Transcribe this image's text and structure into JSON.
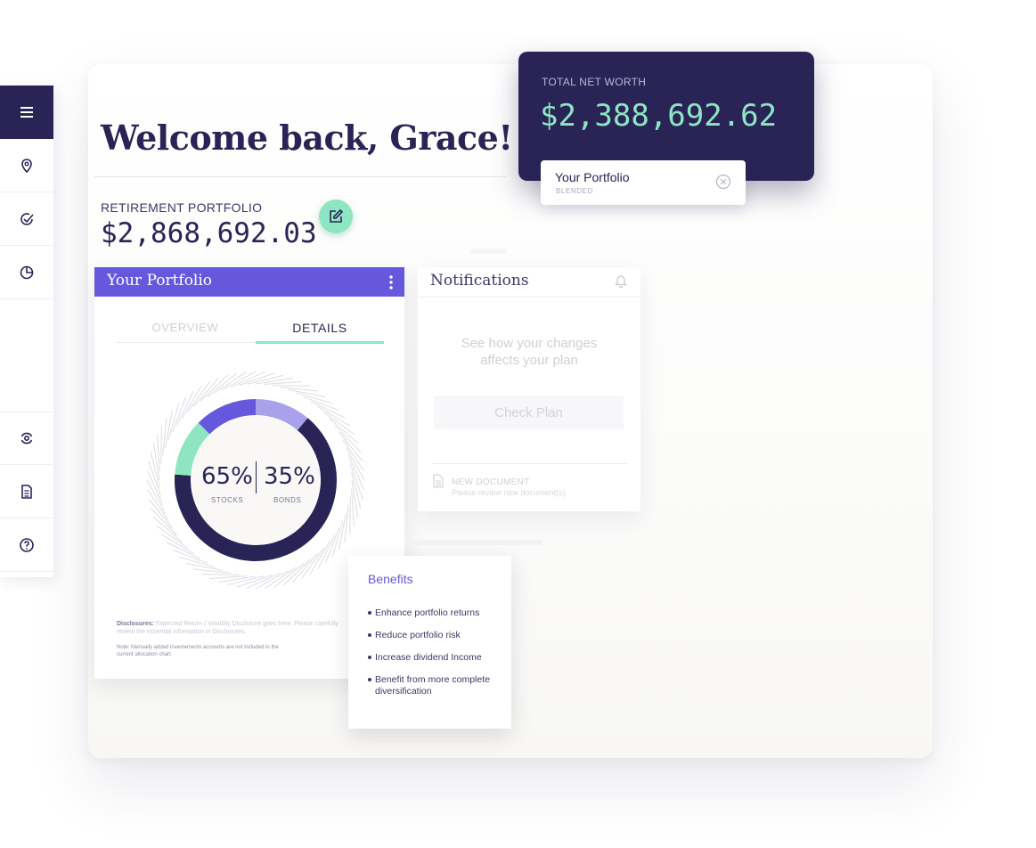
{
  "greeting": "Welcome back, Grace!",
  "retirement": {
    "label": "RETIREMENT PORTFOLIO",
    "value": "$2,868,692.03"
  },
  "net_worth": {
    "label": "TOTAL NET WORTH",
    "value": "$2,388,692.62"
  },
  "portfolio_pill": {
    "title": "Your Portfolio",
    "subtitle": "BLENDED"
  },
  "portfolio_card": {
    "title": "Your Portfolio",
    "tabs": [
      {
        "label": "OVERVIEW",
        "active": false
      },
      {
        "label": "DETAILS",
        "active": true
      }
    ],
    "allocation": {
      "stocks": {
        "percent": "65%",
        "label": "STOCKS",
        "value": 65
      },
      "bonds": {
        "percent": "35%",
        "label": "BONDS",
        "value": 35
      }
    },
    "disclosures_label": "Disclosures:",
    "disclosures_text": "Expected Return / Volatility Disclosure goes here. Please carefully review the essential information in Disclosures.",
    "note": "Note: Manually added investements accounts are not included in the current allocation chart."
  },
  "notifications": {
    "title": "Notifications",
    "message": "See how your changes affects your plan",
    "button": "Check Plan",
    "document": {
      "title": "NEW DOCUMENT",
      "subtitle": "Please review new document(s)"
    }
  },
  "benefits": {
    "title": "Benefits",
    "items": [
      "Enhance portfolio returns",
      "Reduce portfolio risk",
      "Increase dividend Income",
      "Benefit from more complete diversification"
    ]
  },
  "colors": {
    "navy": "#2a2456",
    "purple": "#6558dc",
    "mint": "#8ee5c2",
    "lavender": "#a9a1ea"
  },
  "icons": [
    "menu-icon",
    "location-pin-icon",
    "check-circle-icon",
    "pie-chart-icon",
    "refresh-target-icon",
    "document-icon",
    "help-icon",
    "edit-icon",
    "close-circle-icon",
    "kebab-icon",
    "bell-icon"
  ]
}
